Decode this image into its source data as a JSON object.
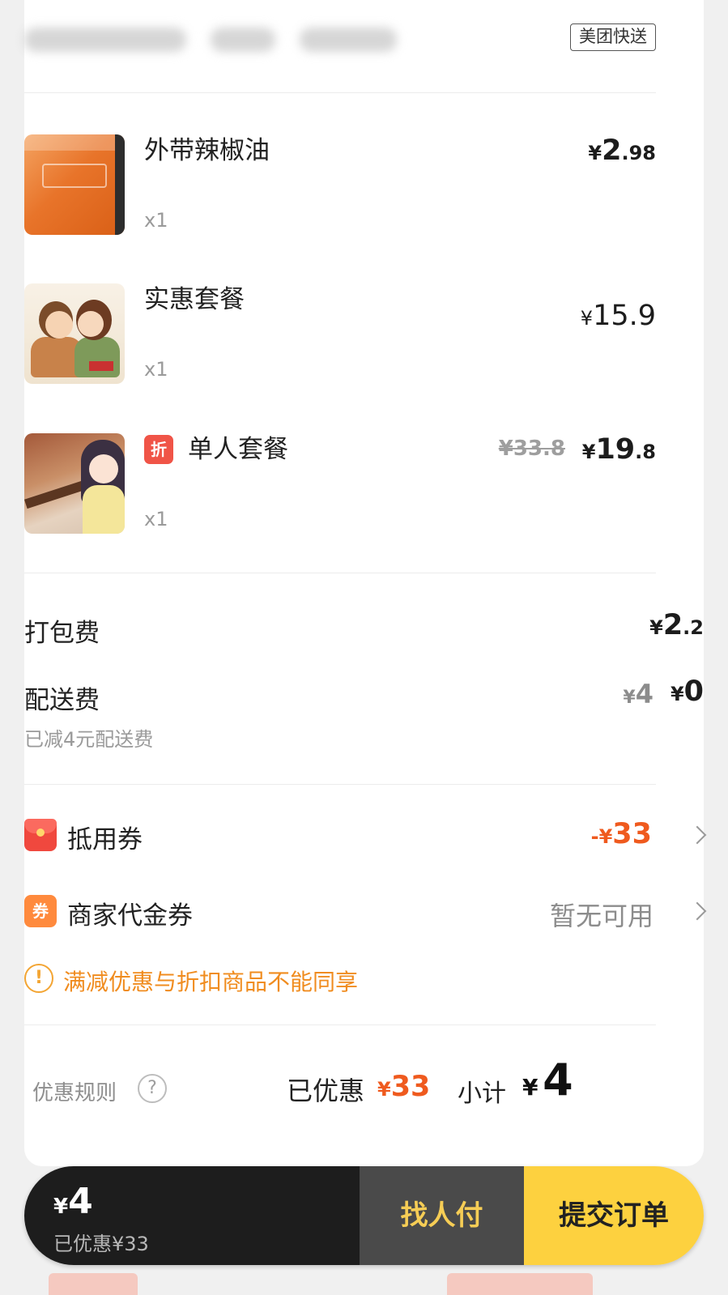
{
  "shop": {
    "delivery_tag": "美团快送"
  },
  "items": [
    {
      "name": "外带辣椒油",
      "qty": "x1",
      "price_int": "2",
      "price_dec": ".98",
      "thumbnail": "chili-oil-packet"
    },
    {
      "name": "实惠套餐",
      "qty": "x1",
      "price_int": "15.9",
      "price_dec": "",
      "thumbnail": "cartoon-couple"
    },
    {
      "name": "单人套餐",
      "qty": "x1",
      "discount_badge": "折",
      "orig_price": "¥33.8",
      "price_int": "19",
      "price_dec": ".8",
      "thumbnail": "anime-girl"
    }
  ],
  "currency": "¥",
  "fees": {
    "packing_label": "打包费",
    "packing_int": "2",
    "packing_dec": ".2",
    "delivery_label": "配送费",
    "delivery_old": "4",
    "delivery_new": "0",
    "delivery_note": "已减4元配送费"
  },
  "coupons": {
    "discount_label": "抵用券",
    "discount_minus": "-",
    "discount_value": "33",
    "merchant_label": "商家代金券",
    "merchant_voucher_glyph": "券",
    "merchant_value": "暂无可用"
  },
  "notice": {
    "icon": "!",
    "text": "满减优惠与折扣商品不能同享"
  },
  "summary": {
    "rules_label": "优惠规则",
    "rules_help": "?",
    "saved_label": "已优惠",
    "saved_value": "33",
    "subtotal_label": "小计",
    "subtotal_value": "4"
  },
  "bottom_bar": {
    "total": "4",
    "saved_text": "已优惠¥33",
    "pay_other_label": "找人付",
    "submit_label": "提交订单"
  },
  "colors": {
    "accent_orange": "#ef5a1e",
    "notice_orange": "#f08c1f",
    "submit_yellow": "#fdd13f",
    "pay_other_text": "#f6cd55",
    "bar_dark": "#1d1d1d"
  }
}
